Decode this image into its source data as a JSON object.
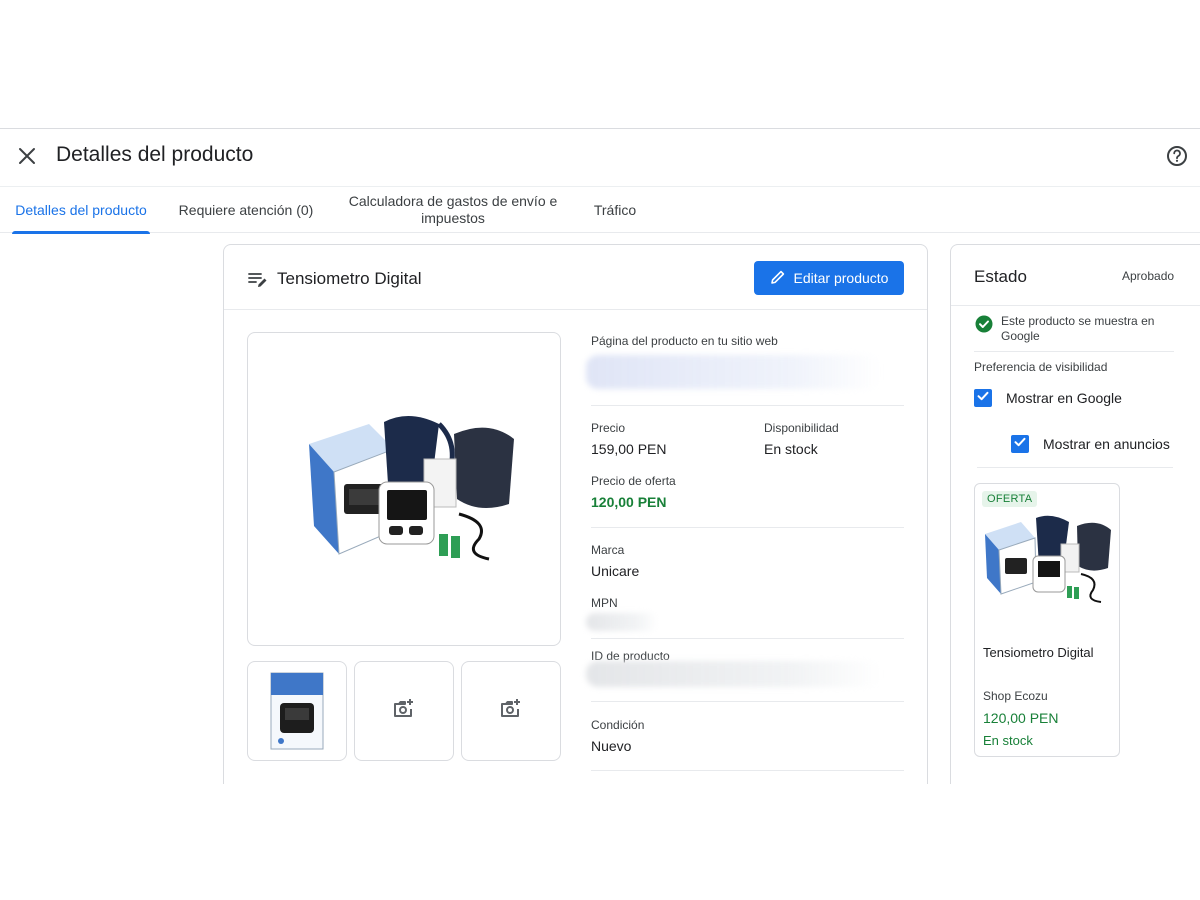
{
  "header": {
    "title": "Detalles del producto"
  },
  "tabs": [
    {
      "label": "Detalles del producto",
      "active": true
    },
    {
      "label": "Requiere atención (0)",
      "active": false
    },
    {
      "label": "Calculadora de gastos de envío e impuestos",
      "active": false
    },
    {
      "label": "Tráfico",
      "active": false
    }
  ],
  "product": {
    "title": "Tensiometro Digital",
    "edit_label": "Editar producto",
    "fields": {
      "page_label": "Página del producto en tu sitio web",
      "price_label": "Precio",
      "price_value": "159,00 PEN",
      "availability_label": "Disponibilidad",
      "availability_value": "En stock",
      "sale_label": "Precio de oferta",
      "sale_value": "120,00 PEN",
      "brand_label": "Marca",
      "brand_value": "Unicare",
      "mpn_label": "MPN",
      "id_label": "ID de producto",
      "condition_label": "Condición",
      "condition_value": "Nuevo"
    }
  },
  "status": {
    "title": "Estado",
    "value": "Aprobado",
    "message": "Este producto se muestra en Google",
    "visibility_label": "Preferencia de visibilidad",
    "show_google": "Mostrar en Google",
    "show_ads": "Mostrar en anuncios"
  },
  "preview": {
    "badge": "OFERTA",
    "title": "Tensiometro Digital",
    "shop": "Shop Ecozu",
    "price": "120,00 PEN",
    "stock": "En stock"
  },
  "colors": {
    "accent": "#1a73e8",
    "success": "#188038",
    "border": "#dadce0"
  },
  "icons": [
    "close-icon",
    "help-icon",
    "notes-edit-icon",
    "pencil-icon",
    "check-circle-icon",
    "checkbox-checked-icon",
    "add-photo-icon"
  ]
}
